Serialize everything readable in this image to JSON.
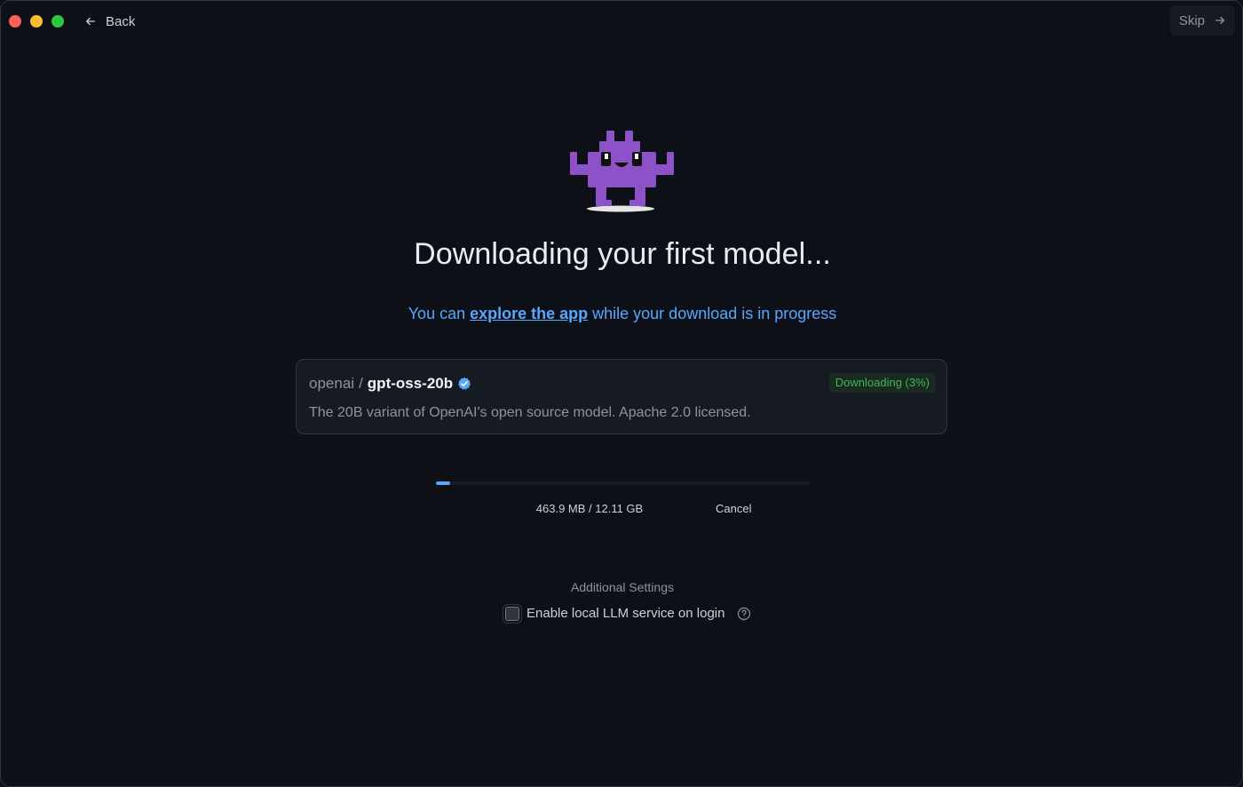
{
  "header": {
    "back_label": "Back",
    "skip_label": "Skip"
  },
  "main": {
    "title": "Downloading your first model...",
    "subtitle_prefix": "You can ",
    "subtitle_link": "explore the app",
    "subtitle_suffix": " while your download is in progress"
  },
  "model": {
    "org": "openai",
    "separator": "/",
    "name": "gpt-oss-20b",
    "verified": true,
    "status": "Downloading (3%)",
    "description": "The 20B variant of OpenAI's open source model. Apache 2.0 licensed."
  },
  "download": {
    "progress_fraction": 0.038,
    "size_text": "463.9 MB / 12.11 GB",
    "cancel_label": "Cancel"
  },
  "settings": {
    "heading": "Additional Settings",
    "service_label": "Enable local LLM service on login",
    "service_enabled": false
  },
  "colors": {
    "background": "#0d1117",
    "accent": "#58a6ff",
    "mascot": "#8e52c8",
    "status_green": "#3fb950"
  },
  "icons": {
    "back": "arrow-left-icon",
    "skip": "arrow-right-icon",
    "verified": "verified-badge-icon",
    "help": "question-circle-icon",
    "mascot": "robot-mascot-logo"
  }
}
